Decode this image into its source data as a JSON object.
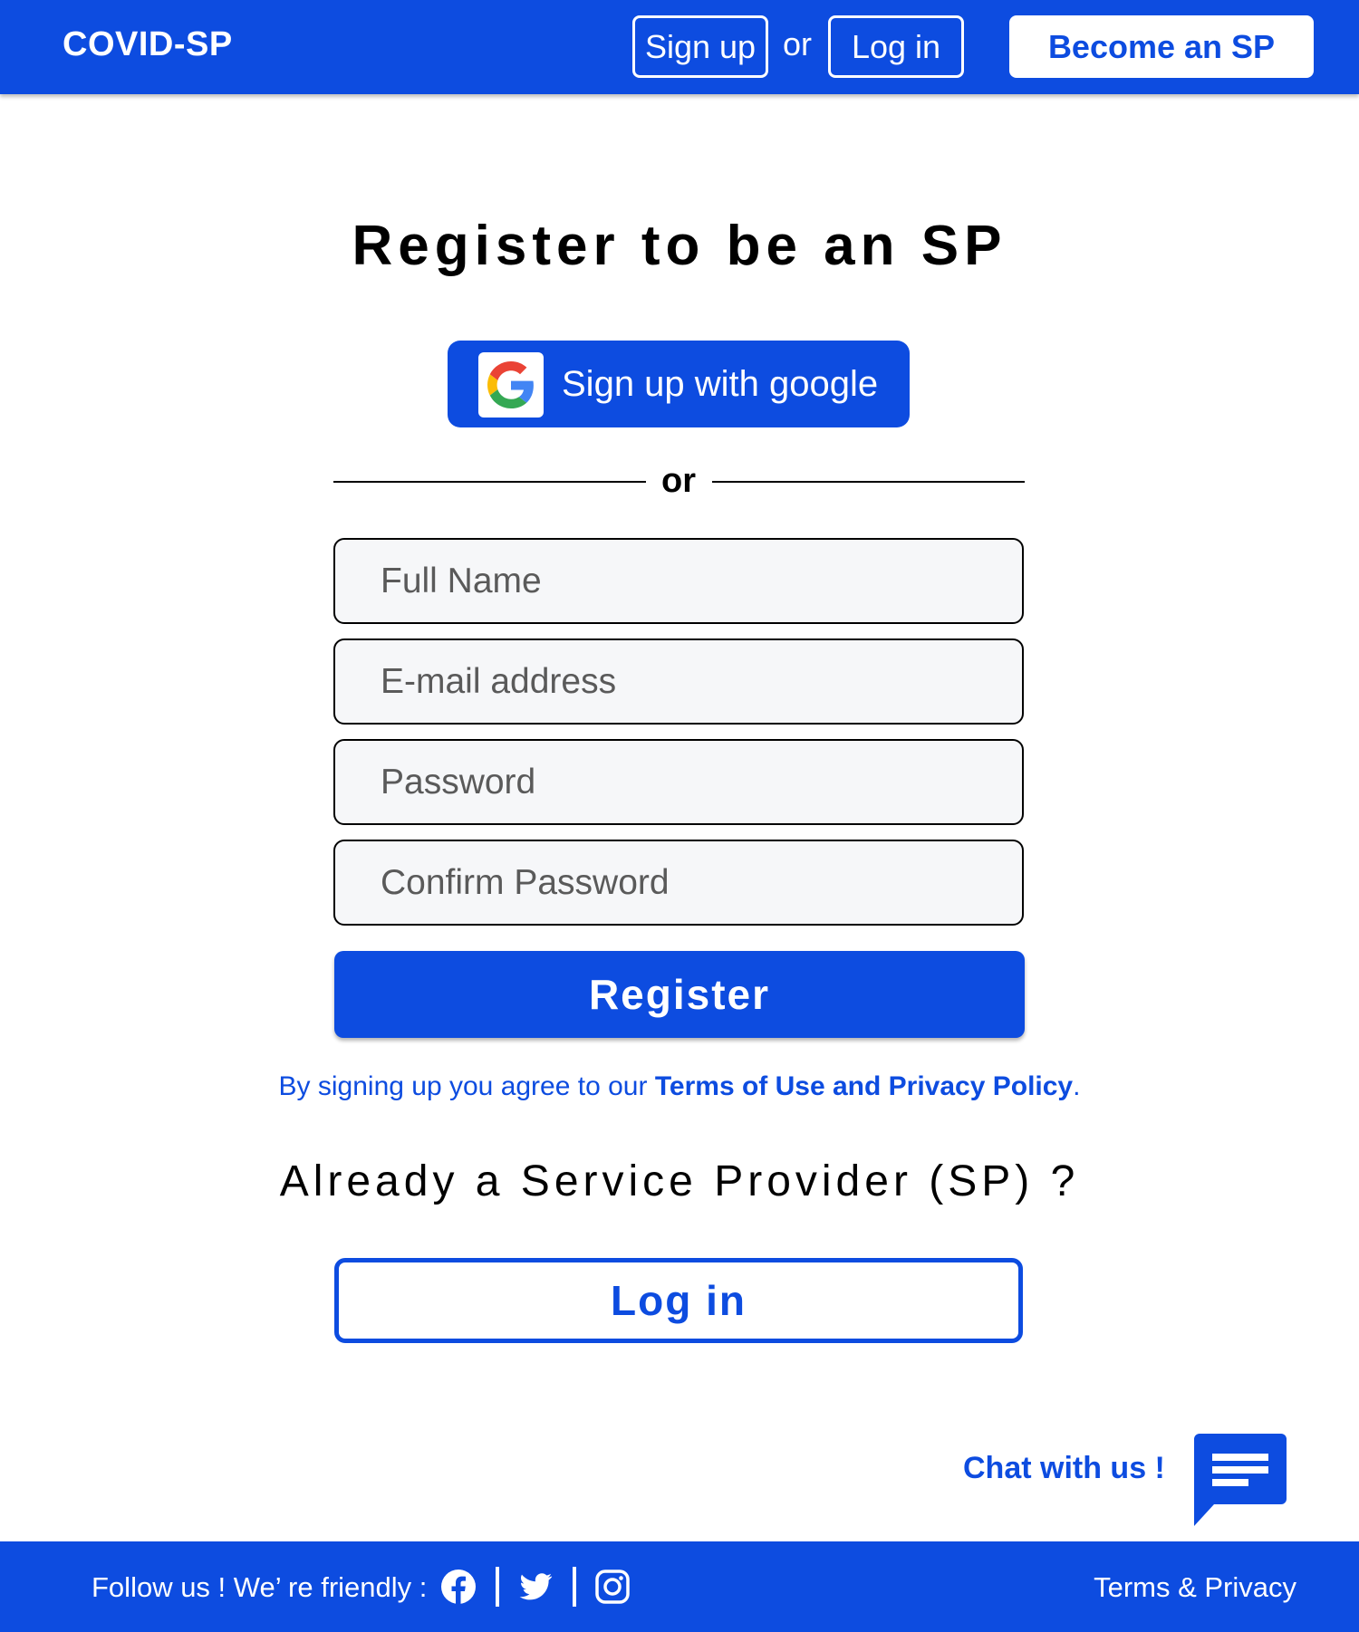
{
  "header": {
    "brand": "COVID-SP",
    "signup_label": "Sign up",
    "or_label": "or",
    "login_label": "Log in",
    "become_label": "Become an SP"
  },
  "main": {
    "title": "Register to be an SP",
    "google_label": "Sign up with google",
    "divider_label": "or",
    "fields": {
      "full_name_placeholder": "Full Name",
      "email_placeholder": "E-mail address",
      "password_placeholder": "Password",
      "confirm_password_placeholder": "Confirm Password"
    },
    "register_label": "Register",
    "terms_prefix": "By signing up you agree to our ",
    "terms_link": "Terms of Use and Privacy Policy",
    "terms_suffix": ".",
    "already_heading": "Already a Service Provider (SP) ?",
    "login_label": "Log in"
  },
  "chat": {
    "label": "Chat with us !",
    "icon": "chat-bubble-icon"
  },
  "footer": {
    "follow_label": "Follow us !  We’ re friendly :",
    "socials": [
      "facebook-icon",
      "twitter-icon",
      "instagram-icon"
    ],
    "terms_label": "Terms & Privacy"
  },
  "colors": {
    "brand_blue": "#0d4ce0",
    "field_bg": "#f6f7f9",
    "white": "#ffffff"
  }
}
